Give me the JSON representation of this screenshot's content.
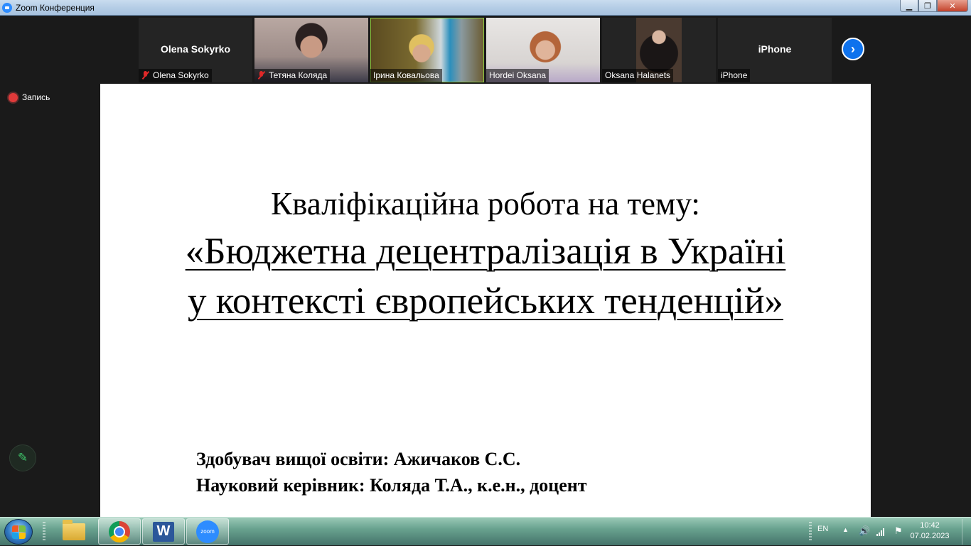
{
  "window": {
    "title": "Zoom Конференция",
    "minimize": "▁",
    "maximize": "❐",
    "close": "✕"
  },
  "participants": [
    {
      "display": "Olena Sokyrko",
      "label": "Olena Sokyrko",
      "muted": true,
      "video": false
    },
    {
      "label": "Тетяна Коляда",
      "muted": true,
      "video": true
    },
    {
      "label": "Ірина Ковальова",
      "muted": false,
      "video": true,
      "active_speaker": true
    },
    {
      "label": "Hordei Oksana",
      "muted": false,
      "video": true
    },
    {
      "label": "Oksana Halanets",
      "muted": false,
      "video": true
    },
    {
      "display": "iPhone",
      "label": "iPhone",
      "muted": false,
      "video": false
    }
  ],
  "next_page_icon": "›",
  "recording": {
    "label": "Запись",
    "icon": "record-dot-icon"
  },
  "annotate_icon": "✎",
  "slide": {
    "line1": "Кваліфікаційна робота на тему:",
    "line2": "«Бюджетна децентралізація в Україні",
    "line3": "у контексті європейських тенденцій»",
    "author_line": "Здобувач вищої освіти: Ажичаков С.С.",
    "supervisor_line": "Науковий керівник: Коляда Т.А., к.е.н., доцент"
  },
  "taskbar": {
    "items": [
      "start-button",
      "file-explorer",
      "google-chrome",
      "microsoft-word",
      "zoom"
    ],
    "word_letter": "W",
    "zoom_text": "zoom",
    "language": "EN",
    "tray_arrow": "▲",
    "volume_icon": "🔊",
    "flag_icon": "⚑",
    "time": "10:42",
    "date": "07.02.2023"
  },
  "colors": {
    "zoom_blue": "#2d8cff",
    "active_speaker_border": "#8dc63f",
    "record_red": "#e03a3a",
    "muted_red": "#e02828"
  }
}
